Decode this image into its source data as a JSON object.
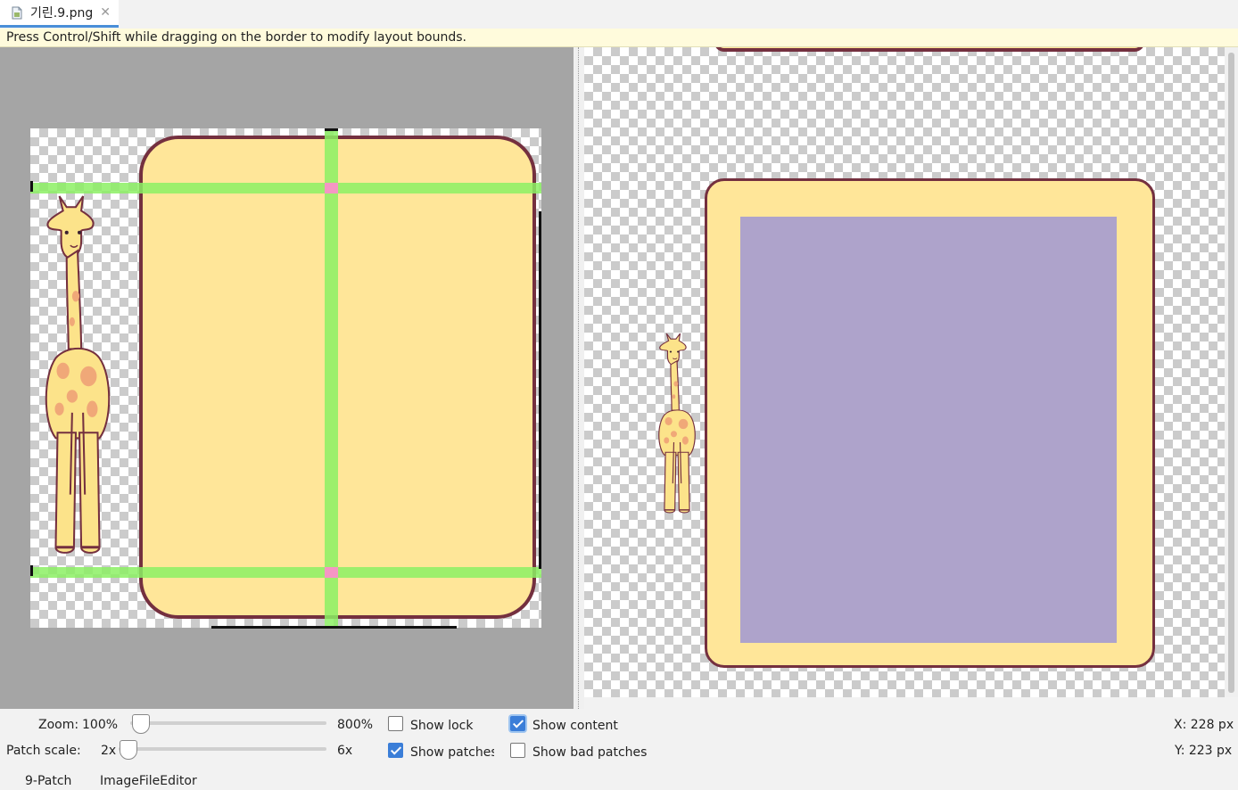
{
  "tab": {
    "filename": "기린.9.png",
    "close_glyph": "✕",
    "icon": "file-icon"
  },
  "hint": {
    "text": "Press Control/Shift while dragging on the border to modify layout bounds."
  },
  "zoom": {
    "label": "Zoom:",
    "value": "100%",
    "max_label": "800%",
    "position": 0.0
  },
  "patch_scale": {
    "label": "Patch scale:",
    "min_label": "2x",
    "max_label": "6x",
    "position": 0.0
  },
  "checkboxes": {
    "show_lock": {
      "label": "Show lock",
      "checked": false
    },
    "show_content": {
      "label": "Show content",
      "checked": true
    },
    "show_patches": {
      "label": "Show patches",
      "checked": true
    },
    "show_bad_patches": {
      "label": "Show bad patches",
      "checked": false
    }
  },
  "coords": {
    "x": "X: 228 px",
    "y": "Y: 223 px"
  },
  "bottom_tabs": [
    {
      "label": "9-Patch"
    },
    {
      "label": "ImageFileEditor"
    }
  ],
  "colors": {
    "box_fill": "#ffe699",
    "box_border": "#74303f",
    "content_fill": "#aea3cb",
    "patch_green": "#8cf064",
    "patch_pink": "#f596c4",
    "checkbox_accent": "#3b7ed8"
  }
}
